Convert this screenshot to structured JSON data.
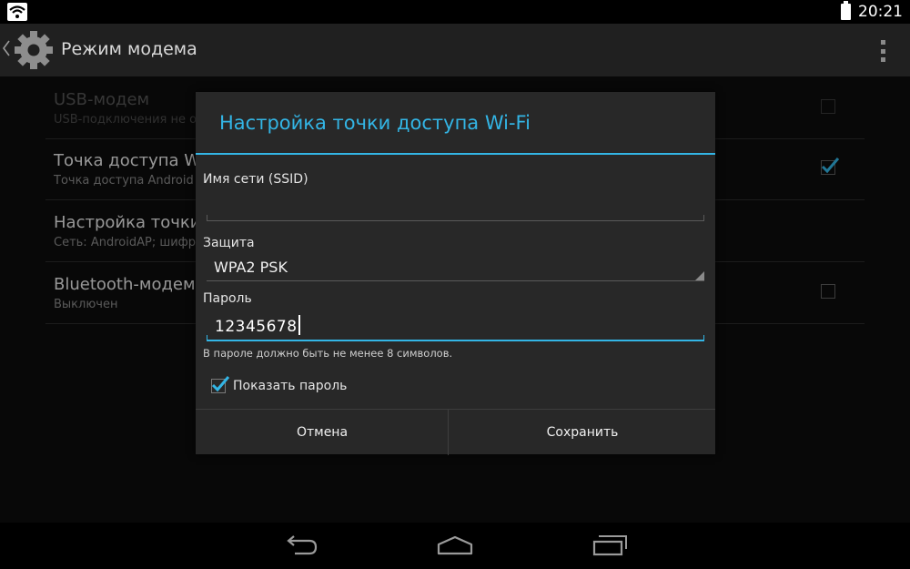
{
  "status_bar": {
    "time": "20:21",
    "left_icon": "wifi-hotspot-icon",
    "battery_icon": "battery-icon"
  },
  "action_bar": {
    "title": "Режим модема",
    "back_icon": "chevron-left-icon",
    "app_icon": "settings-gear-icon",
    "overflow_icon": "overflow-menu-icon"
  },
  "preferences": [
    {
      "title": "USB-модем",
      "summary": "USB-подключения не о",
      "checked": false,
      "enabled": false
    },
    {
      "title": "Точка доступа Wi-",
      "summary": "Точка доступа Android",
      "checked": true,
      "enabled": true
    },
    {
      "title": "Настройка точки д",
      "summary": "Сеть: AndroidAP; шифр",
      "enabled": true
    },
    {
      "title": "Bluetooth-модем",
      "summary": "Выключен",
      "checked": false,
      "enabled": true
    }
  ],
  "dialog": {
    "title": "Настройка точки доступа Wi-Fi",
    "ssid": {
      "label": "Имя сети (SSID)",
      "value": ""
    },
    "security": {
      "label": "Защита",
      "selected": "WPA2 PSK"
    },
    "password": {
      "label": "Пароль",
      "value": "12345678",
      "hint": "В пароле должно быть не менее 8 символов."
    },
    "show_password": {
      "label": "Показать пароль",
      "checked": true
    },
    "cancel_label": "Отмена",
    "save_label": "Сохранить"
  },
  "nav_bar": {
    "back_icon": "back-icon",
    "home_icon": "home-icon",
    "recents_icon": "recent-apps-icon"
  },
  "colors": {
    "accent": "#33b5e5",
    "dialog_bg": "#282828",
    "action_bar_bg": "#202020"
  }
}
